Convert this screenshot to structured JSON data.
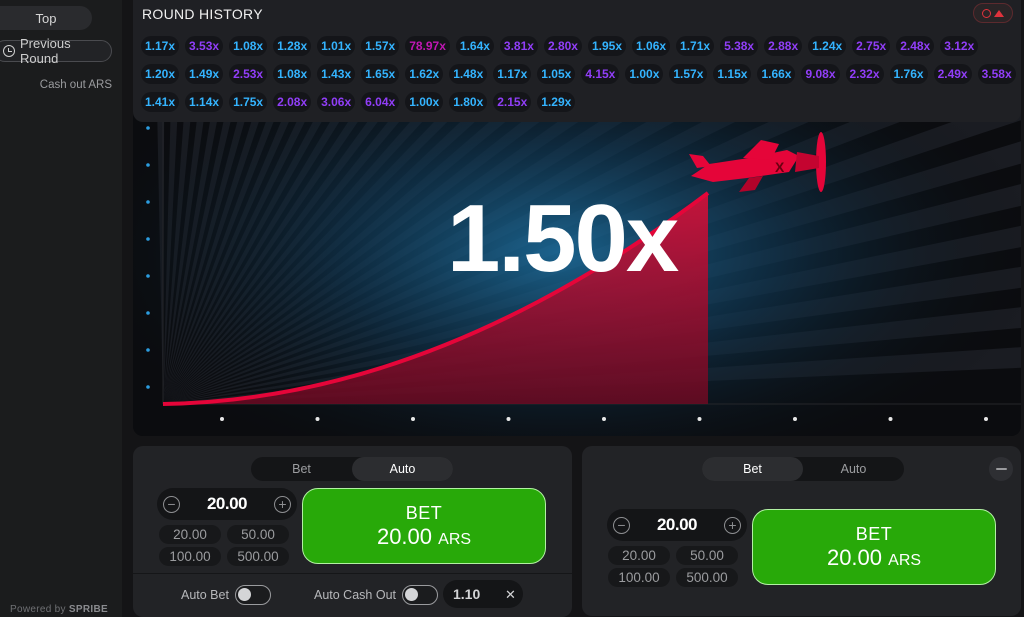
{
  "sidebar": {
    "tab_top": "Top",
    "previous_round": "Previous Round",
    "cash_out_label": "Cash out ARS",
    "powered_by": "Powered by",
    "powered_brand": "SPRIBE"
  },
  "history": {
    "title": "ROUND HISTORY",
    "items": [
      {
        "v": "1.17x",
        "c": "blue"
      },
      {
        "v": "3.53x",
        "c": "purple"
      },
      {
        "v": "1.08x",
        "c": "blue"
      },
      {
        "v": "1.28x",
        "c": "blue"
      },
      {
        "v": "1.01x",
        "c": "blue"
      },
      {
        "v": "1.57x",
        "c": "blue"
      },
      {
        "v": "78.97x",
        "c": "pink"
      },
      {
        "v": "1.64x",
        "c": "blue"
      },
      {
        "v": "3.81x",
        "c": "purple"
      },
      {
        "v": "2.80x",
        "c": "purple"
      },
      {
        "v": "1.95x",
        "c": "blue"
      },
      {
        "v": "1.06x",
        "c": "blue"
      },
      {
        "v": "1.71x",
        "c": "blue"
      },
      {
        "v": "5.38x",
        "c": "purple"
      },
      {
        "v": "2.88x",
        "c": "purple"
      },
      {
        "v": "1.24x",
        "c": "blue"
      },
      {
        "v": "2.75x",
        "c": "purple"
      },
      {
        "v": "2.48x",
        "c": "purple"
      },
      {
        "v": "3.12x",
        "c": "purple"
      },
      {
        "v": "1.20x",
        "c": "blue"
      },
      {
        "v": "1.49x",
        "c": "blue"
      },
      {
        "v": "2.53x",
        "c": "purple"
      },
      {
        "v": "1.08x",
        "c": "blue"
      },
      {
        "v": "1.43x",
        "c": "blue"
      },
      {
        "v": "1.65x",
        "c": "blue"
      },
      {
        "v": "1.62x",
        "c": "blue"
      },
      {
        "v": "1.48x",
        "c": "blue"
      },
      {
        "v": "1.17x",
        "c": "blue"
      },
      {
        "v": "1.05x",
        "c": "blue"
      },
      {
        "v": "4.15x",
        "c": "purple"
      },
      {
        "v": "1.00x",
        "c": "blue"
      },
      {
        "v": "1.57x",
        "c": "blue"
      },
      {
        "v": "1.15x",
        "c": "blue"
      },
      {
        "v": "1.66x",
        "c": "blue"
      },
      {
        "v": "9.08x",
        "c": "purple"
      },
      {
        "v": "2.32x",
        "c": "purple"
      },
      {
        "v": "1.76x",
        "c": "blue"
      },
      {
        "v": "2.49x",
        "c": "purple"
      },
      {
        "v": "3.58x",
        "c": "purple"
      },
      {
        "v": "1.41x",
        "c": "blue"
      },
      {
        "v": "1.14x",
        "c": "blue"
      },
      {
        "v": "1.75x",
        "c": "blue"
      },
      {
        "v": "2.08x",
        "c": "purple"
      },
      {
        "v": "3.06x",
        "c": "purple"
      },
      {
        "v": "6.04x",
        "c": "purple"
      },
      {
        "v": "1.00x",
        "c": "blue"
      },
      {
        "v": "1.80x",
        "c": "blue"
      },
      {
        "v": "2.15x",
        "c": "purple"
      },
      {
        "v": "1.29x",
        "c": "blue"
      }
    ]
  },
  "game": {
    "multiplier": "1.50x",
    "curve_color": "#e50539",
    "plane_color": "#e50539"
  },
  "bet_left": {
    "tab_bet": "Bet",
    "tab_auto": "Auto",
    "active_tab": "Auto",
    "amount": "20.00",
    "quick": [
      "20.00",
      "50.00",
      "100.00",
      "500.00"
    ],
    "button_line1": "BET",
    "button_amount": "20.00",
    "button_currency": "ARS",
    "auto_bet_label": "Auto Bet",
    "auto_cashout_label": "Auto Cash Out",
    "auto_cashout_value": "1.10"
  },
  "bet_right": {
    "tab_bet": "Bet",
    "tab_auto": "Auto",
    "active_tab": "Bet",
    "amount": "20.00",
    "quick": [
      "20.00",
      "50.00",
      "100.00",
      "500.00"
    ],
    "button_line1": "BET",
    "button_amount": "20.00",
    "button_currency": "ARS"
  },
  "colors": {
    "accent_green": "#28a909",
    "chip_blue": "#34b4ff",
    "chip_purple": "#913ef8",
    "chip_pink": "#c017b4"
  }
}
